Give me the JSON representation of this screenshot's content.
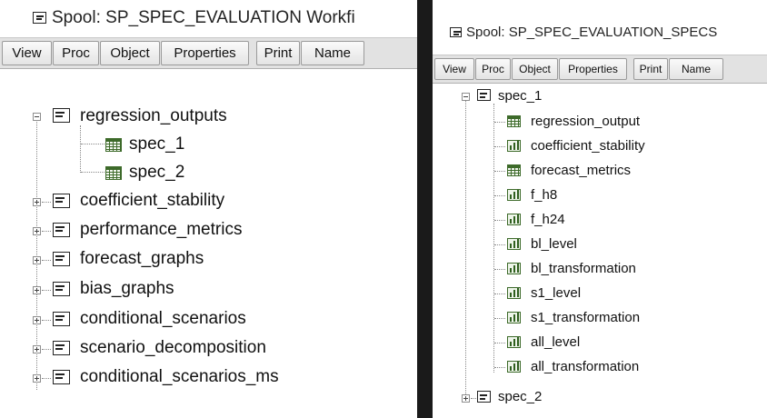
{
  "left_window": {
    "title": "Spool: SP_SPEC_EVALUATION   Workfi",
    "toolbar": [
      "View",
      "Proc",
      "Object",
      "Properties",
      "Print",
      "Name"
    ],
    "tree": [
      {
        "label": "regression_outputs",
        "expanded": true,
        "icon": "spool-icon",
        "children": [
          {
            "label": "spec_1",
            "icon": "table-icon"
          },
          {
            "label": "spec_2",
            "icon": "table-icon"
          }
        ]
      },
      {
        "label": "coefficient_stability",
        "expanded": false,
        "icon": "spool-icon"
      },
      {
        "label": "performance_metrics",
        "expanded": false,
        "icon": "spool-icon"
      },
      {
        "label": "forecast_graphs",
        "expanded": false,
        "icon": "spool-icon"
      },
      {
        "label": "bias_graphs",
        "expanded": false,
        "icon": "spool-icon"
      },
      {
        "label": "conditional_scenarios",
        "expanded": false,
        "icon": "spool-icon"
      },
      {
        "label": "scenario_decomposition",
        "expanded": false,
        "icon": "spool-icon"
      },
      {
        "label": "conditional_scenarios_ms",
        "expanded": false,
        "icon": "spool-icon"
      }
    ]
  },
  "right_window": {
    "title": "Spool: SP_SPEC_EVALUATION_SPECS",
    "toolbar": [
      "View",
      "Proc",
      "Object",
      "Properties",
      "Print",
      "Name"
    ],
    "tree": [
      {
        "label": "spec_1",
        "expanded": true,
        "icon": "spool-icon",
        "children": [
          {
            "label": "regression_output",
            "icon": "table-icon"
          },
          {
            "label": "coefficient_stability",
            "icon": "graph-icon"
          },
          {
            "label": "forecast_metrics",
            "icon": "table-icon"
          },
          {
            "label": "f_h8",
            "icon": "graph-icon"
          },
          {
            "label": "f_h24",
            "icon": "graph-icon"
          },
          {
            "label": "bl_level",
            "icon": "graph-icon"
          },
          {
            "label": "bl_transformation",
            "icon": "graph-icon"
          },
          {
            "label": "s1_level",
            "icon": "graph-icon"
          },
          {
            "label": "s1_transformation",
            "icon": "graph-icon"
          },
          {
            "label": "all_level",
            "icon": "graph-icon"
          },
          {
            "label": "all_transformation",
            "icon": "graph-icon"
          }
        ]
      },
      {
        "label": "spec_2",
        "expanded": false,
        "icon": "spool-icon"
      }
    ]
  }
}
